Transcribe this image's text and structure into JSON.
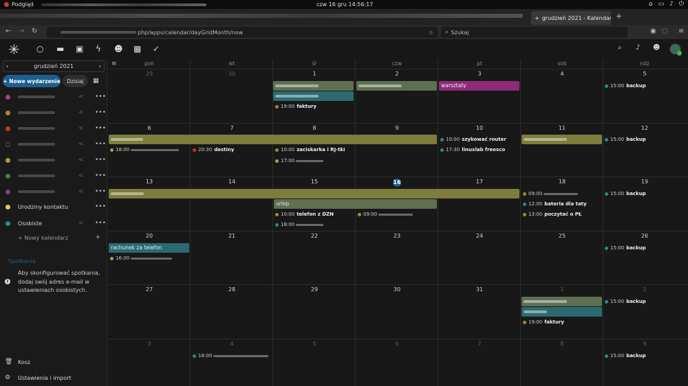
{
  "system": {
    "app_name": "Podgląd",
    "clock": "czw 16 gru  14:56:17"
  },
  "browser": {
    "tab_title": "grudzień 2021 - Kalendarz",
    "url_visible": "php/apps/calendar/dayGridMonth/now",
    "search_placeholder": "Szukaj"
  },
  "sidebar": {
    "month_label": "grudzień 2021",
    "new_event": "+ Nowe wydarzenie",
    "today": "Dzisiaj",
    "calendars": [
      {
        "name": "",
        "color": "#b0407a"
      },
      {
        "name": "",
        "color": "#a88a2e"
      },
      {
        "name": "",
        "color": "#c0392b"
      },
      {
        "name": "",
        "color": "#333333"
      },
      {
        "name": "",
        "color": "#a3a34d"
      },
      {
        "name": "",
        "color": "#4e7a4e"
      },
      {
        "name": "",
        "color": "#8e3a8e"
      },
      {
        "name": "Urodziny kontaktu",
        "color": "#e6d045"
      },
      {
        "name": "Osobiste",
        "color": "#2f8a8a"
      }
    ],
    "new_calendar": "+ Nowy kalendarz",
    "appointments_title": "Spotkania",
    "appointments_info": "Aby skonfigurować spotkania, dodaj swój adres e-mail w ustawieniach osobistych.",
    "trash": "Kosz",
    "settings": "Ustawienia i import"
  },
  "calendar": {
    "weekdays": [
      "pon",
      "wt",
      "śr",
      "czw",
      "pt",
      "sob",
      "ndz"
    ],
    "weeks": [
      [
        "29",
        "30",
        "1",
        "2",
        "3",
        "4",
        "5"
      ],
      [
        "6",
        "7",
        "8",
        "9",
        "10",
        "11",
        "12"
      ],
      [
        "13",
        "14",
        "15",
        "16",
        "17",
        "18",
        "19"
      ],
      [
        "20",
        "21",
        "22",
        "23",
        "24",
        "25",
        "26"
      ],
      [
        "27",
        "28",
        "29",
        "30",
        "31",
        "1",
        "2"
      ],
      [
        "3",
        "4",
        "5",
        "6",
        "7",
        "8",
        "9"
      ]
    ],
    "today_label": "16",
    "events": {
      "e_faktury1_time": "19:00",
      "e_faktury1_title": "faktury",
      "e_warsztaty": "warsztaty",
      "e_backup1_time": "15:00",
      "e_backup1_title": "backup",
      "e_w2_1_time": "18:00",
      "e_destiny_time": "20:30",
      "e_destiny_title": "destiny",
      "e_zacisk_time": "10:00",
      "e_zacisk_title": "zaciskarka i RJ-tki",
      "e_w2_2_time": "17:00",
      "e_router_time": "10:00",
      "e_router_title": "szykować router",
      "e_linux_time": "17:30",
      "e_linux_title": "linuxlab freesco",
      "e_backup2_time": "15:00",
      "e_backup2_title": "backup",
      "e_urlop": "urlop",
      "e_dzn_time": "10:00",
      "e_dzn_title": "telefon z DZN",
      "e_w3_18_time": "18:00",
      "e_w3_16_time": "09:00",
      "e_w3_sob1_time": "09:00",
      "e_bateria_time": "12:00",
      "e_bateria_title": "bateria dla taty",
      "e_pl_time": "13:00",
      "e_pl_title": "poczytać o PŁ",
      "e_backup3_time": "15:00",
      "e_backup3_title": "backup",
      "e_rachunek": "rachunek za telefon",
      "e_w4_time": "16:00",
      "e_backup4_time": "15:00",
      "e_backup4_title": "backup",
      "e_backup5_time": "15:00",
      "e_backup5_title": "backup",
      "e_faktury2_time": "19:00",
      "e_faktury2_title": "faktury",
      "e_w6_time": "18:00",
      "e_backup6_time": "15:00",
      "e_backup6_title": "backup"
    }
  },
  "colors": {
    "accent": "#1d5f8f",
    "olive": "#7d7d3c",
    "green_gray": "#5e6f52",
    "teal": "#2b6a70",
    "magenta": "#8e2a78"
  }
}
